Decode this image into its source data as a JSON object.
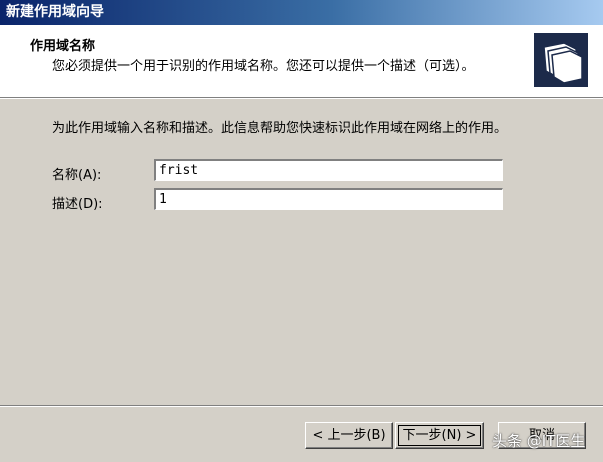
{
  "window": {
    "title": "新建作用域向导"
  },
  "header": {
    "title": "作用域名称",
    "subtitle": "您必须提供一个用于识别的作用域名称。您还可以提供一个描述（可选）。",
    "icon": "folders-icon"
  },
  "body": {
    "instruction": "为此作用域输入名称和描述。此信息帮助您快速标识此作用域在网络上的作用。",
    "name_label": "名称(A):",
    "name_value": "frist",
    "desc_label": "描述(D):",
    "desc_value": "1"
  },
  "buttons": {
    "back": "< 上一步(B)",
    "next": "下一步(N) >",
    "cancel": "取消"
  },
  "watermark": "头条 @IT医生",
  "colors": {
    "titlebar_start": "#0a246a",
    "titlebar_end": "#a6caf0",
    "face": "#d4d0c8"
  }
}
